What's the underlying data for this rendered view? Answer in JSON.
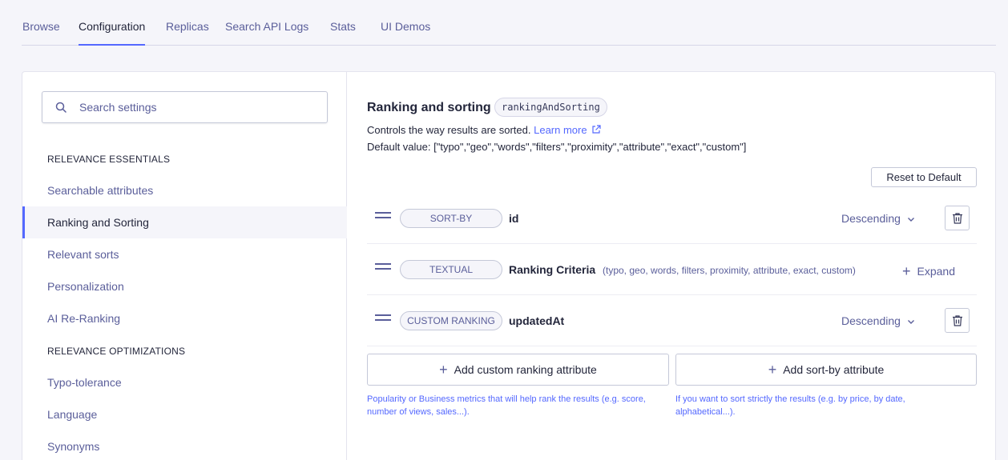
{
  "tabs": [
    {
      "label": "Browse"
    },
    {
      "label": "Configuration"
    },
    {
      "label": "Replicas"
    },
    {
      "label": "Search API Logs"
    },
    {
      "label": "Stats"
    },
    {
      "label": "UI Demos"
    }
  ],
  "sidebar": {
    "search_placeholder": "Search settings",
    "section1": "RELEVANCE ESSENTIALS",
    "section2": "RELEVANCE OPTIMIZATIONS",
    "items": [
      {
        "label": "Searchable attributes"
      },
      {
        "label": "Ranking and Sorting"
      },
      {
        "label": "Relevant sorts"
      },
      {
        "label": "Personalization"
      },
      {
        "label": "AI Re-Ranking"
      },
      {
        "label": "Typo-tolerance"
      },
      {
        "label": "Language"
      },
      {
        "label": "Synonyms"
      }
    ]
  },
  "main": {
    "title": "Ranking and sorting",
    "tag": "rankingAndSorting",
    "description": "Controls the way results are sorted.",
    "learn_more": "Learn more",
    "default_value": "Default value: [\"typo\",\"geo\",\"words\",\"filters\",\"proximity\",\"attribute\",\"exact\",\"custom\"]",
    "reset_label": "Reset to Default",
    "rows": [
      {
        "type": "SORT-BY",
        "name": "id",
        "order": "Descending"
      },
      {
        "type": "TEXTUAL",
        "name": "Ranking Criteria",
        "sub": "(typo, geo, words, filters, proximity, attribute, exact, custom)",
        "action": "Expand"
      },
      {
        "type": "CUSTOM RANKING",
        "name": "updatedAt",
        "order": "Descending"
      }
    ],
    "add_custom_label": "Add custom ranking attribute",
    "add_sort_label": "Add sort-by attribute",
    "help_custom": "Popularity or Business metrics that will help rank the results (e.g. score, number of views, sales...).",
    "help_sort": "If you want to sort strictly the results (e.g. by price, by date, alphabetical...)."
  }
}
